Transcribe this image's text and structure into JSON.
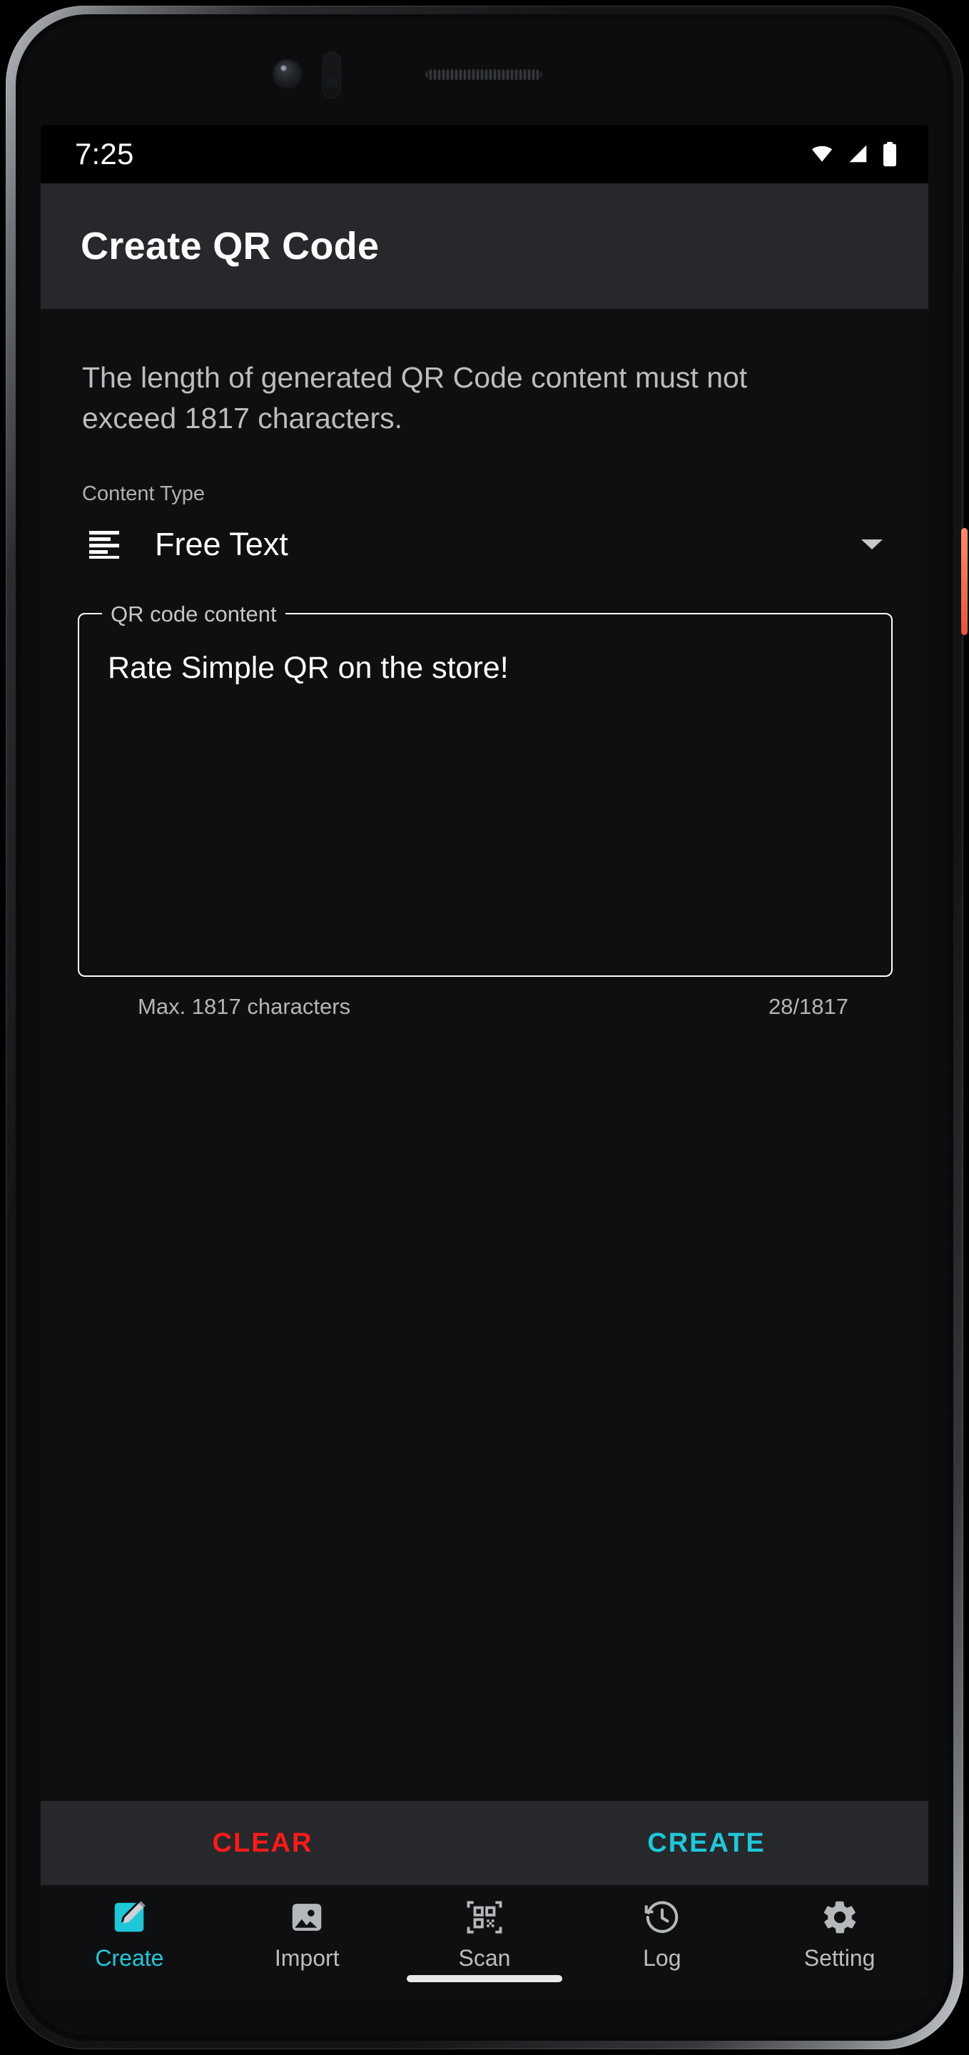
{
  "status_bar": {
    "time": "7:25",
    "icons": [
      "wifi-icon",
      "signal-icon",
      "battery-icon"
    ]
  },
  "app_bar": {
    "title": "Create QR Code"
  },
  "main": {
    "description": "The length of generated QR Code content must not exceed 1817 characters.",
    "content_type": {
      "label": "Content Type",
      "value": "Free Text",
      "icon": "text-align-left-icon",
      "caret": "chevron-down-icon"
    },
    "qr_field": {
      "label": "QR code content",
      "value": "Rate Simple QR on the store!",
      "helper": "Max. 1817 characters",
      "counter": "28/1817"
    }
  },
  "actions": {
    "clear_label": "CLEAR",
    "create_label": "CREATE",
    "clear_color": "#ff1a1a",
    "create_color": "#1ec8d8"
  },
  "bottom_nav": {
    "active_index": 0,
    "active_color": "#1ec8d8",
    "inactive_color": "#bdbdbd",
    "items": [
      {
        "label": "Create",
        "icon": "create-edit-icon"
      },
      {
        "label": "Import",
        "icon": "image-icon"
      },
      {
        "label": "Scan",
        "icon": "qr-scan-icon"
      },
      {
        "label": "Log",
        "icon": "history-clock-icon"
      },
      {
        "label": "Setting",
        "icon": "gear-icon"
      }
    ]
  }
}
